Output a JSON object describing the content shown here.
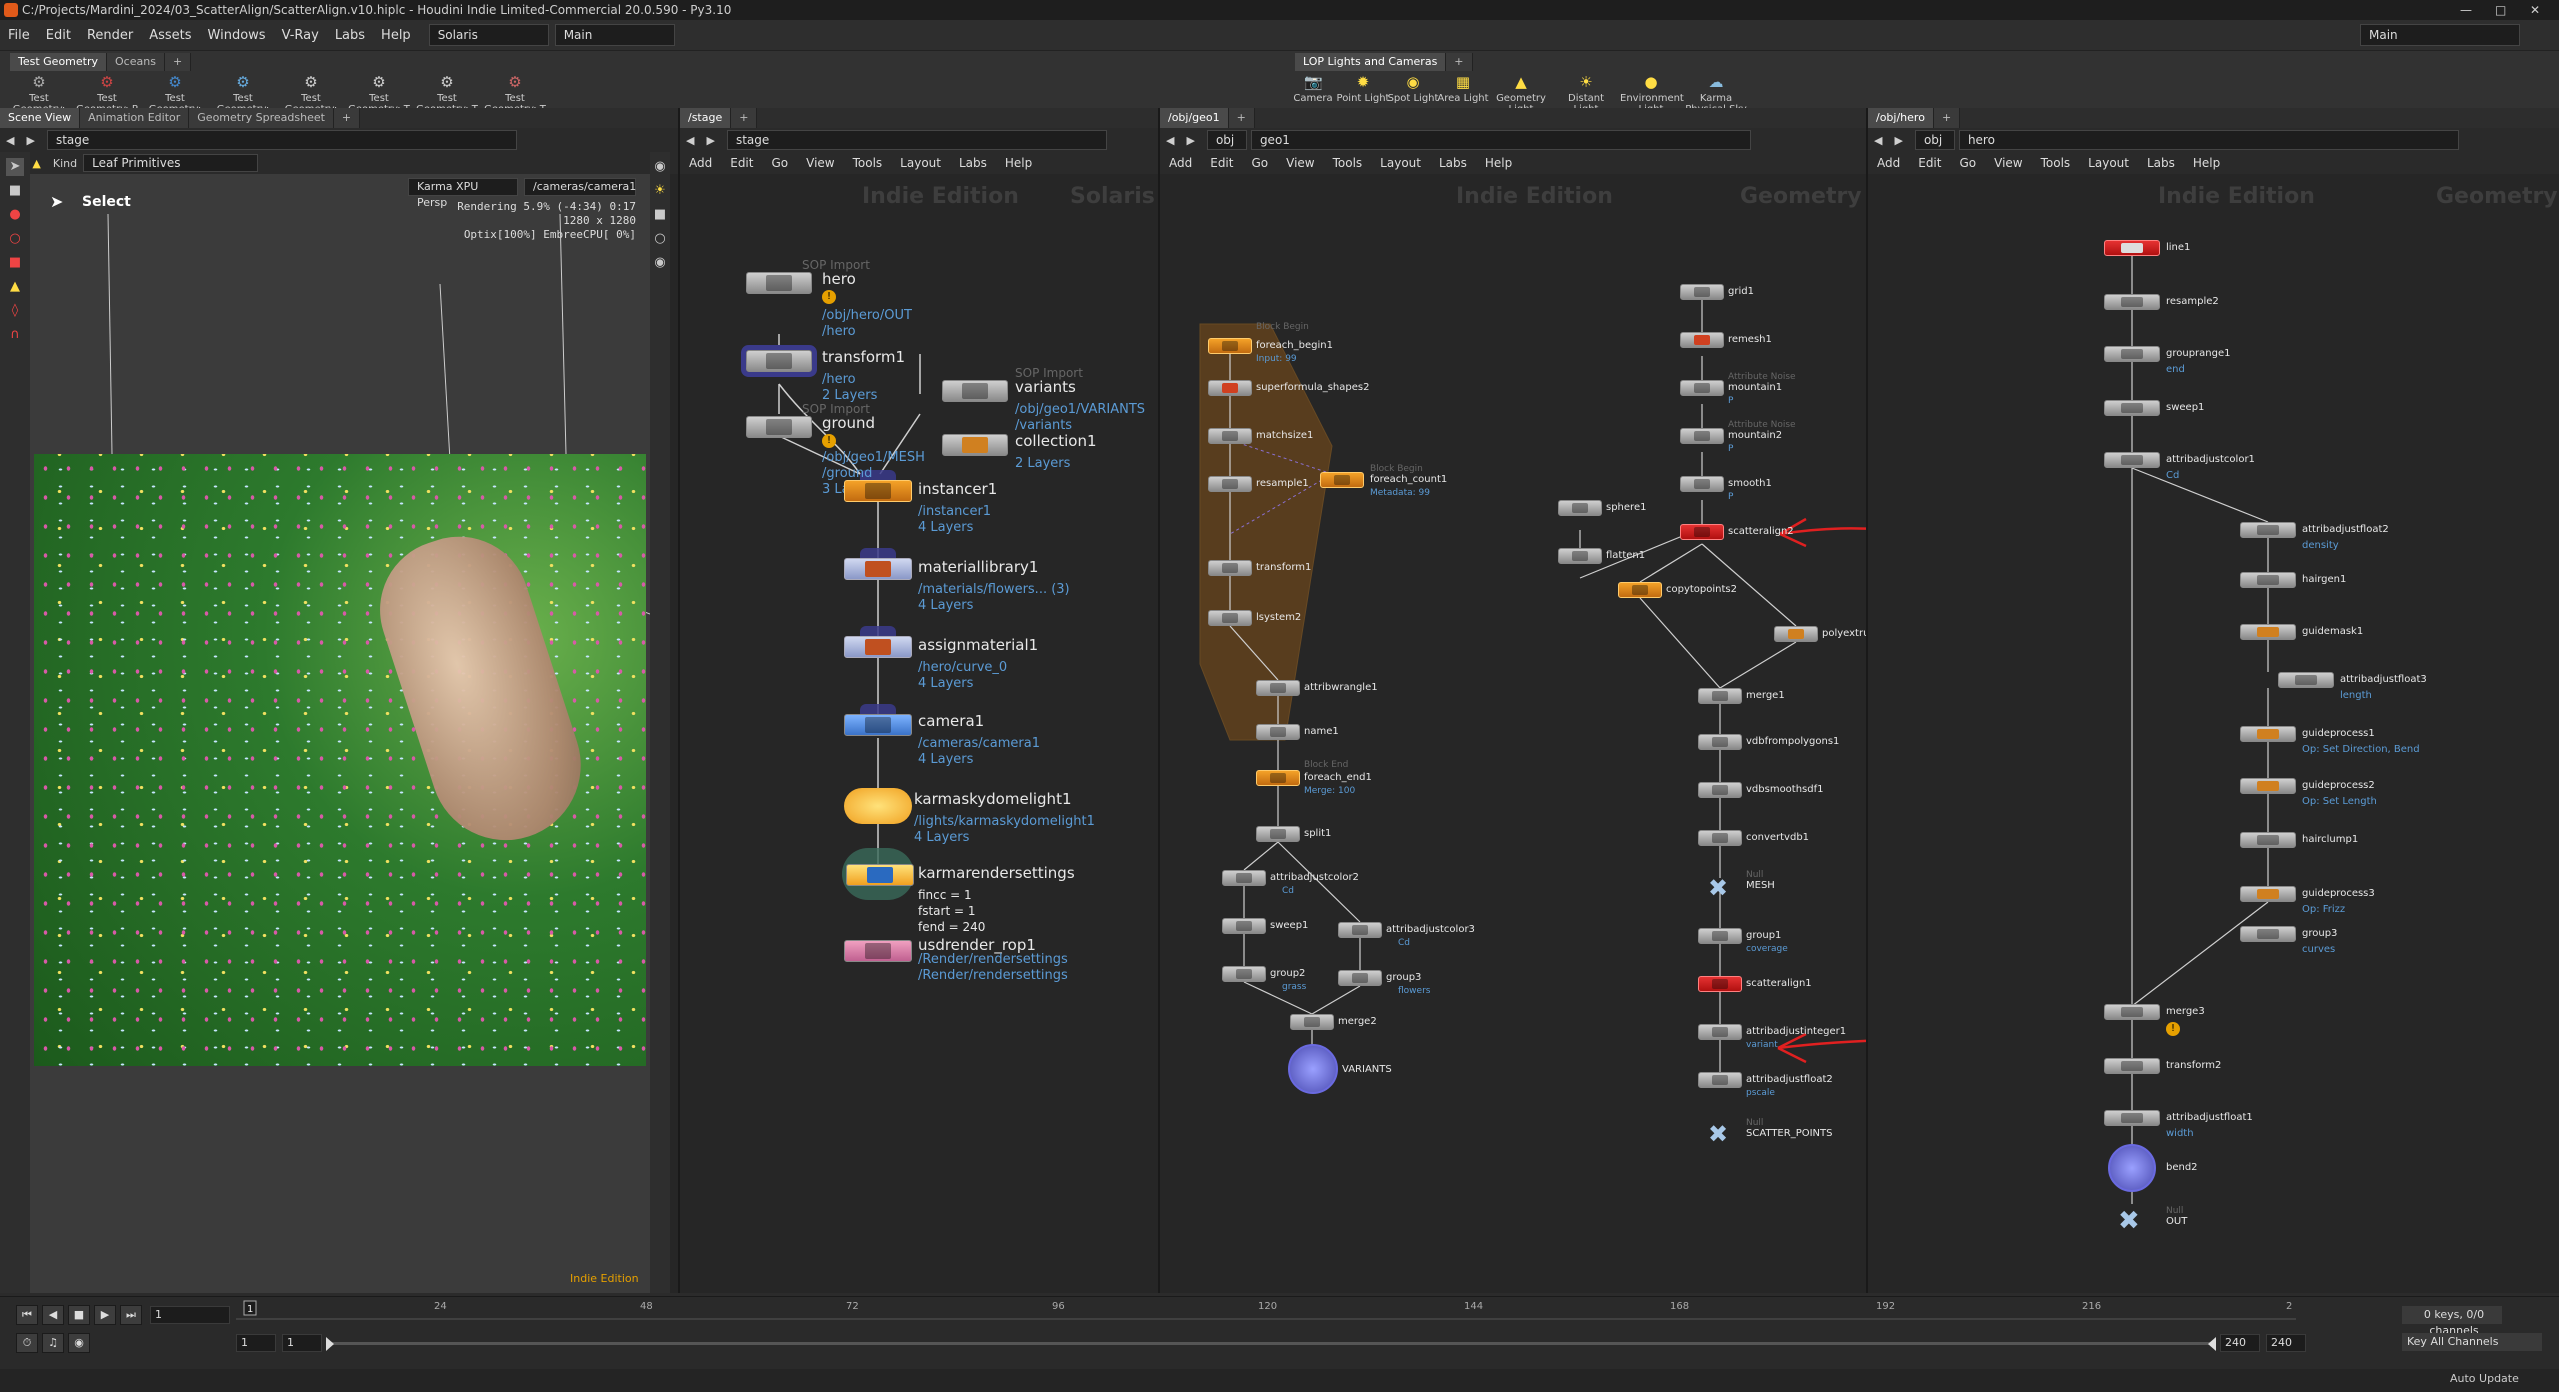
{
  "window": {
    "title": "C:/Projects/Mardini_2024/03_ScatterAlign/ScatterAlign.v10.hiplc - Houdini Indie Limited-Commercial 20.0.590 - Py3.10"
  },
  "menus": [
    "File",
    "Edit",
    "Render",
    "Assets",
    "Windows",
    "V-Ray",
    "Labs",
    "Help"
  ],
  "desktop": "Solaris",
  "main_combo": "Main",
  "main_right": "Main",
  "shelf_left": {
    "tabs": [
      "Test Geometry",
      "Oceans"
    ],
    "tools": [
      "Test Geometry: C",
      "Test Geometry: P",
      "Test Geometry: R",
      "Test Geometry: S",
      "Test Geometry: S",
      "Test Geometry: T",
      "Test Geometry: T",
      "Test Geometry: T"
    ]
  },
  "shelf_right": {
    "tabs": [
      "LOP Lights and Cameras"
    ],
    "tools": [
      "Camera",
      "Point Light",
      "Spot Light",
      "Area Light",
      "Geometry Light",
      "Distant Light",
      "Environment Light",
      "Karma Physical Sky"
    ]
  },
  "viewer": {
    "tabs": [
      "Scene View",
      "Animation Editor",
      "Geometry Spreadsheet"
    ],
    "path": "stage",
    "kind_label": "Kind",
    "kind_value": "Leaf Primitives",
    "select_label": "Select",
    "renderer": "Karma XPU  Persp",
    "camera": "/cameras/camera1",
    "stats": [
      "Rendering  5.9%  (-4:34)  0:17",
      "1280 x 1280",
      "Optix[100%] EmbreeCPU[  0%]"
    ],
    "watermark": "Indie Edition"
  },
  "stage_pane": {
    "tab": "/stage",
    "path": "stage",
    "watermark": "Indie Edition",
    "context": "Solaris",
    "menu": [
      "Add",
      "Edit",
      "Go",
      "View",
      "Tools",
      "Layout",
      "Labs",
      "Help"
    ],
    "nodes": {
      "hero": {
        "type": "SOP Import",
        "name": "hero",
        "p1": "/obj/hero/OUT",
        "p2": "/hero"
      },
      "transform1": {
        "name": "transform1",
        "p1": "/hero",
        "p2": "2 Layers"
      },
      "ground": {
        "type": "SOP Import",
        "name": "ground",
        "p1": "/obj/geo1/MESH",
        "p2": "/ground",
        "p3": "3 Layers"
      },
      "variants": {
        "type": "SOP Import",
        "name": "variants",
        "p1": "/obj/geo1/VARIANTS",
        "p2": "/variants"
      },
      "collection1": {
        "name": "collection1",
        "p1": "2 Layers"
      },
      "instancer1": {
        "name": "instancer1",
        "p1": "/instancer1",
        "p2": "4 Layers"
      },
      "materiallibrary1": {
        "name": "materiallibrary1",
        "p1": "/materials/flowers... (3)",
        "p2": "4 Layers"
      },
      "assignmaterial1": {
        "name": "assignmaterial1",
        "p1": "/hero/curve_0",
        "p2": "4 Layers"
      },
      "camera1": {
        "name": "camera1",
        "p1": "/cameras/camera1",
        "p2": "4 Layers"
      },
      "karmaskydomelight1": {
        "name": "karmaskydomelight1",
        "p1": "/lights/karmaskydomelight1",
        "p2": "4 Layers"
      },
      "karmarendersettings": {
        "name": "karmarendersettings",
        "p1": "fincc = 1",
        "p2": "fstart = 1",
        "p3": "fend = 240"
      },
      "usdrender_rop1": {
        "name": "usdrender_rop1",
        "p1": "/Render/rendersettings",
        "p2": "/Render/rendersettings"
      }
    }
  },
  "geo1_pane": {
    "tab": "/obj/geo1",
    "path1": "obj",
    "path2": "geo1",
    "watermark": "Indie Edition",
    "context": "Geometry",
    "menu": [
      "Add",
      "Edit",
      "Go",
      "View",
      "Tools",
      "Layout",
      "Labs",
      "Help"
    ],
    "nodes": {
      "foreach_begin1": {
        "name": "foreach_begin1",
        "tag": "Block Begin",
        "p1": "Input: 99"
      },
      "superformula_shapes2": {
        "name": "superformula_shapes2"
      },
      "matchsize1": {
        "name": "matchsize1"
      },
      "resample1": {
        "name": "resample1"
      },
      "foreach_count1": {
        "name": "foreach_count1",
        "tag": "Block Begin",
        "p1": "Metadata: 99"
      },
      "transform1": {
        "name": "transform1"
      },
      "lsystem2": {
        "name": "lsystem2"
      },
      "attribwrangle1": {
        "name": "attribwrangle1"
      },
      "name1": {
        "name": "name1"
      },
      "foreach_end1": {
        "name": "foreach_end1",
        "tag": "Block End",
        "p1": "Merge: 100"
      },
      "split1": {
        "name": "split1"
      },
      "attribadjustcolor2": {
        "name": "attribadjustcolor2",
        "p1": "Cd"
      },
      "sweep1": {
        "name": "sweep1"
      },
      "group2": {
        "name": "group2",
        "p1": "grass"
      },
      "attribadjustcolor3": {
        "name": "attribadjustcolor3",
        "p1": "Cd"
      },
      "group3": {
        "name": "group3",
        "p1": "flowers"
      },
      "merge2": {
        "name": "merge2"
      },
      "VARIANTS": {
        "name": "VARIANTS"
      },
      "grid1": {
        "name": "grid1"
      },
      "remesh1": {
        "name": "remesh1"
      },
      "mountain1": {
        "name": "mountain1",
        "tag": "Attribute Noise",
        "p1": "P"
      },
      "mountain2": {
        "name": "mountain2",
        "tag": "Attribute Noise",
        "p1": "P"
      },
      "smooth1": {
        "name": "smooth1",
        "p1": "P"
      },
      "sphere1": {
        "name": "sphere1"
      },
      "flatten1": {
        "name": "flatten1"
      },
      "scatteralign2": {
        "name": "scatteralign2"
      },
      "copytopoints2": {
        "name": "copytopoints2"
      },
      "polyextrude": {
        "name": "polyextru"
      },
      "merge1": {
        "name": "merge1"
      },
      "vdbfrompolygons1": {
        "name": "vdbfrompolygons1"
      },
      "vdbsmoothsdf1": {
        "name": "vdbsmoothsdf1"
      },
      "convertvdb1": {
        "name": "convertvdb1"
      },
      "MESH": {
        "name": "MESH",
        "tag": "Null"
      },
      "group1": {
        "name": "group1",
        "p1": "coverage"
      },
      "scatteralign1": {
        "name": "scatteralign1"
      },
      "attribadjustinteger1": {
        "name": "attribadjustinteger1",
        "p1": "variant"
      },
      "attribadjustfloat2": {
        "name": "attribadjustfloat2",
        "p1": "pscale"
      },
      "SCATTER_POINTS": {
        "name": "SCATTER_POINTS",
        "tag": "Null"
      }
    }
  },
  "hero_pane": {
    "tab": "/obj/hero",
    "path1": "obj",
    "path2": "hero",
    "watermark": "Indie Edition",
    "context": "Geometry",
    "menu": [
      "Add",
      "Edit",
      "Go",
      "View",
      "Tools",
      "Layout",
      "Labs",
      "Help"
    ],
    "nodes": {
      "line1": {
        "name": "line1"
      },
      "resample2": {
        "name": "resample2"
      },
      "grouprange1": {
        "name": "grouprange1",
        "p1": "end"
      },
      "sweep1": {
        "name": "sweep1"
      },
      "attribadjustcolor1": {
        "name": "attribadjustcolor1",
        "p1": "Cd"
      },
      "attribadjustfloat2": {
        "name": "attribadjustfloat2",
        "p1": "density"
      },
      "hairgen1": {
        "name": "hairgen1"
      },
      "guidemask1": {
        "name": "guidemask1"
      },
      "attribadjustfloat3": {
        "name": "attribadjustfloat3",
        "p1": "length"
      },
      "guideprocess1": {
        "name": "guideprocess1",
        "p1": "Op: Set Direction, Bend"
      },
      "guideprocess2": {
        "name": "guideprocess2",
        "p1": "Op: Set Length"
      },
      "hairclump1": {
        "name": "hairclump1"
      },
      "guideprocess3": {
        "name": "guideprocess3",
        "p1": "Op: Frizz"
      },
      "group3": {
        "name": "group3",
        "p1": "curves"
      },
      "merge3": {
        "name": "merge3"
      },
      "transform2": {
        "name": "transform2"
      },
      "attribadjustfloat1": {
        "name": "attribadjustfloat1",
        "p1": "width"
      },
      "bend2": {
        "name": "bend2"
      },
      "OUT": {
        "name": "OUT",
        "tag": "Null"
      }
    }
  },
  "timeline": {
    "frame": "1",
    "ticks": [
      "24",
      "48",
      "72",
      "96",
      "120",
      "144",
      "168",
      "192",
      "216",
      "2"
    ],
    "start": "1",
    "start2": "1",
    "end": "240",
    "end2": "240",
    "keys": "0 keys, 0/0 channels",
    "key_all": "Key All Channels",
    "auto_update": "Auto Update"
  },
  "colors": {
    "accent_orange": "#f4a228",
    "red_node": "#e63232",
    "link_blue": "#5b9bd5",
    "annotation_red": "#e02020"
  }
}
